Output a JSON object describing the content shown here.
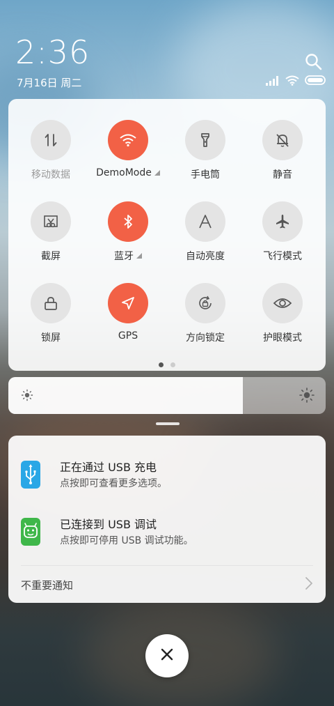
{
  "status": {
    "time": "2:36",
    "date": "7月16日 周二",
    "icons": [
      "signal-icon",
      "wifi-icon",
      "battery-icon"
    ]
  },
  "quick_settings": {
    "tiles": [
      {
        "label": "移动数据",
        "icon": "mobile-data-icon",
        "active": false,
        "disabled": true,
        "expandable": false
      },
      {
        "label": "DemoMode",
        "icon": "wifi-icon",
        "active": true,
        "disabled": false,
        "expandable": true
      },
      {
        "label": "手电筒",
        "icon": "flashlight-icon",
        "active": false,
        "disabled": false,
        "expandable": false
      },
      {
        "label": "静音",
        "icon": "mute-bell-icon",
        "active": false,
        "disabled": false,
        "expandable": false
      },
      {
        "label": "截屏",
        "icon": "screenshot-icon",
        "active": false,
        "disabled": false,
        "expandable": false
      },
      {
        "label": "蓝牙",
        "icon": "bluetooth-icon",
        "active": true,
        "disabled": false,
        "expandable": true
      },
      {
        "label": "自动亮度",
        "icon": "auto-brightness-icon",
        "active": false,
        "disabled": false,
        "expandable": false
      },
      {
        "label": "飞行模式",
        "icon": "airplane-icon",
        "active": false,
        "disabled": false,
        "expandable": false
      },
      {
        "label": "锁屏",
        "icon": "lock-icon",
        "active": false,
        "disabled": false,
        "expandable": false
      },
      {
        "label": "GPS",
        "icon": "gps-icon",
        "active": true,
        "disabled": false,
        "expandable": false
      },
      {
        "label": "方向锁定",
        "icon": "rotation-lock-icon",
        "active": false,
        "disabled": false,
        "expandable": false
      },
      {
        "label": "护眼模式",
        "icon": "eye-icon",
        "active": false,
        "disabled": false,
        "expandable": false
      }
    ],
    "page_count": 2,
    "current_page": 1
  },
  "brightness": {
    "level": 0.74
  },
  "notifications": [
    {
      "title": "正在通过 USB 充电",
      "subtitle": "点按即可查看更多选项。",
      "icon": "usb-icon",
      "icon_color": "#2aa7e6"
    },
    {
      "title": "已连接到 USB 调试",
      "subtitle": "点按即可停用 USB 调试功能。",
      "icon": "android-icon",
      "icon_color": "#3fb74a"
    }
  ],
  "unimportant_label": "不重要通知",
  "colors": {
    "accent": "#f26146",
    "tile_off": "#e4e4e4"
  }
}
